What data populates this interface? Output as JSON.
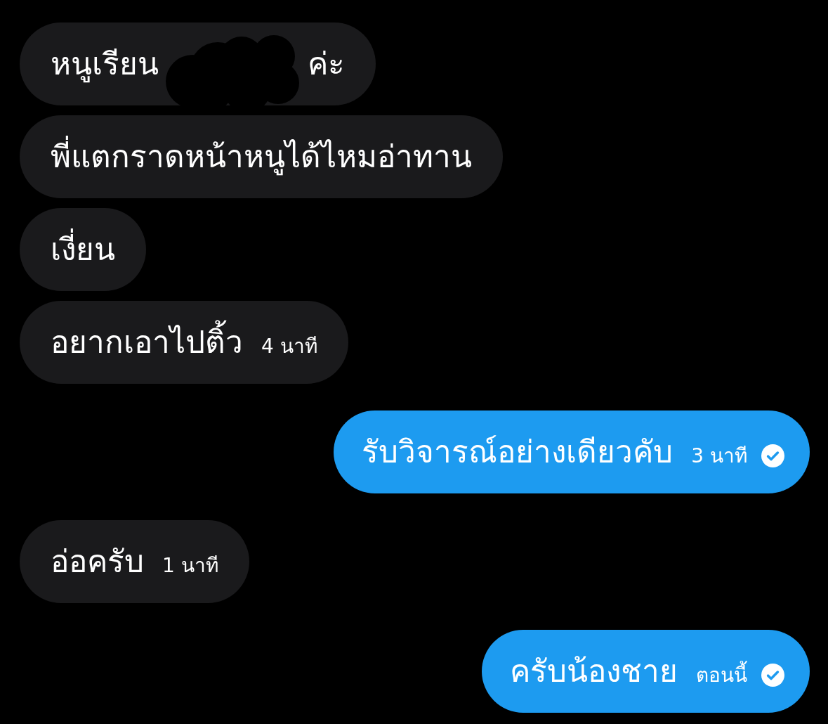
{
  "conversation": {
    "messages": [
      {
        "sent": false,
        "segments": [
          {
            "kind": "text",
            "text": "หนูเรียน"
          },
          {
            "kind": "redaction"
          },
          {
            "kind": "text",
            "text": "ค่ะ"
          }
        ]
      },
      {
        "sent": false,
        "text": "พี่แตกราดหน้าหนูได้ไหมอ่าทาน"
      },
      {
        "sent": false,
        "text": "เงี่ยน"
      },
      {
        "sent": false,
        "text": "อยากเอาไปติ้ว",
        "time": "4 นาที"
      },
      {
        "sent": true,
        "text": "รับวิจารณ์อย่างเดียวคับ",
        "time": "3 นาที",
        "read": true
      },
      {
        "sent": false,
        "text": "อ่อครับ",
        "time": "1 นาที"
      },
      {
        "sent": true,
        "text": "ครับน้องชาย",
        "time": "ตอนนี้",
        "read": true
      }
    ]
  }
}
